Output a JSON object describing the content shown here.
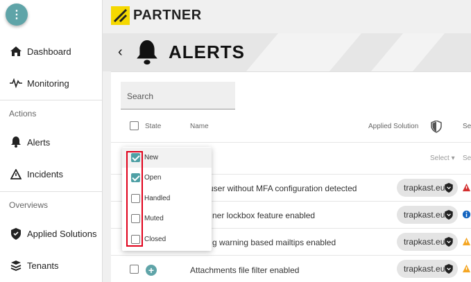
{
  "brand": {
    "name": "PARTNER",
    "logo_color": "#f5d800"
  },
  "sidebar": {
    "menu_glyph": "⋮",
    "items": [
      {
        "label": "Dashboard",
        "icon": "home-icon"
      },
      {
        "label": "Monitoring",
        "icon": "pulse-icon"
      },
      {
        "label": "Alerts",
        "icon": "bell-icon"
      },
      {
        "label": "Incidents",
        "icon": "warning-triangle-icon"
      },
      {
        "label": "Applied Solutions",
        "icon": "shield-icon"
      },
      {
        "label": "Tenants",
        "icon": "layers-icon"
      }
    ],
    "sections": {
      "actions": "Actions",
      "overviews": "Overviews"
    }
  },
  "header": {
    "back": "‹",
    "title": "ALERTS"
  },
  "search": {
    "placeholder": "Search"
  },
  "table": {
    "headers": {
      "state": "State",
      "name": "Name",
      "applied_solution": "Applied Solution",
      "severity": "Sev"
    },
    "filters": {
      "applied_solution": "Select ▾",
      "severity": "Sel"
    },
    "rows": [
      {
        "name": "user without MFA configuration detected",
        "tenant": "trapkast.eu"
      },
      {
        "name": "ner lockbox feature enabled",
        "tenant": "trapkast.eu"
      },
      {
        "name": "g warning based mailtips enabled",
        "tenant": "trapkast.eu"
      },
      {
        "name": "Attachments file filter enabled",
        "tenant": "trapkast.eu"
      }
    ]
  },
  "state_dropdown": {
    "options": [
      {
        "label": "New",
        "checked": true
      },
      {
        "label": "Open",
        "checked": true
      },
      {
        "label": "Handled",
        "checked": false
      },
      {
        "label": "Muted",
        "checked": false
      },
      {
        "label": "Closed",
        "checked": false
      }
    ]
  },
  "colors": {
    "accent": "#5fa4a8",
    "highlight": "#e0001a",
    "severity_high": "#d32f2f",
    "severity_info": "#1565c0",
    "severity_medium": "#f5a623"
  }
}
